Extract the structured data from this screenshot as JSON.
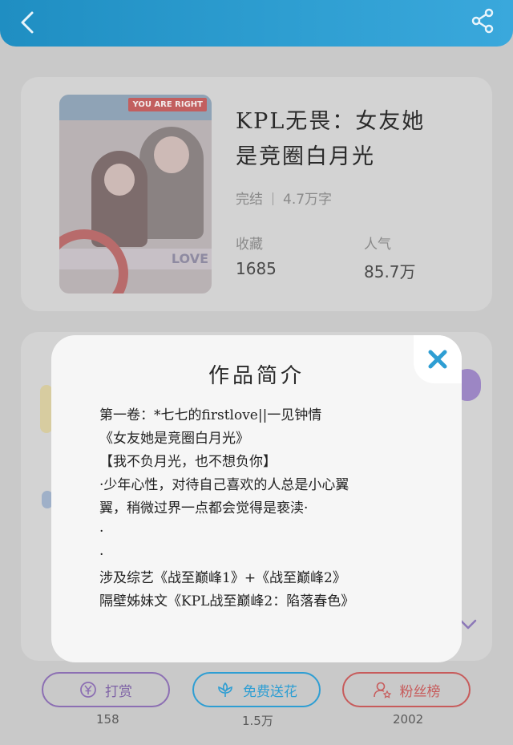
{
  "book": {
    "title_line1": "KPL无畏：女友她",
    "title_line2": "是竞圈白月光",
    "status": "完结",
    "word_count": "4.7万字",
    "cover_tag": "YOU ARE RIGHT",
    "cover_word": "LOVE"
  },
  "stats": {
    "collect_label": "收藏",
    "collect_value": "1685",
    "popularity_label": "人气",
    "popularity_value": "85.7万"
  },
  "modal": {
    "title": "作品简介",
    "lines": [
      "第一卷：*七七的firstlove||一见钟情",
      "《女友她是竞圈白月光》",
      "【我不负月光，也不想负你】",
      "·少年心性，对待自己喜欢的人总是小心翼",
      "翼，稍微过界一点都会觉得是亵渎·",
      "·",
      "·",
      "涉及综艺《战至巅峰1》+《战至巅峰2》",
      "隔壁姊妹文《KPL战至巅峰2：陷落春色》"
    ]
  },
  "actions": [
    {
      "label": "打赏",
      "count": "158"
    },
    {
      "label": "免费送花",
      "count": "1.5万"
    },
    {
      "label": "粉丝榜",
      "count": "2002"
    }
  ],
  "colors": {
    "topbar": "#2f9fd2",
    "reward": "#8c6fb3",
    "flower": "#2e9ed3",
    "fans": "#c75b5b",
    "close": "#2e9ed3"
  }
}
